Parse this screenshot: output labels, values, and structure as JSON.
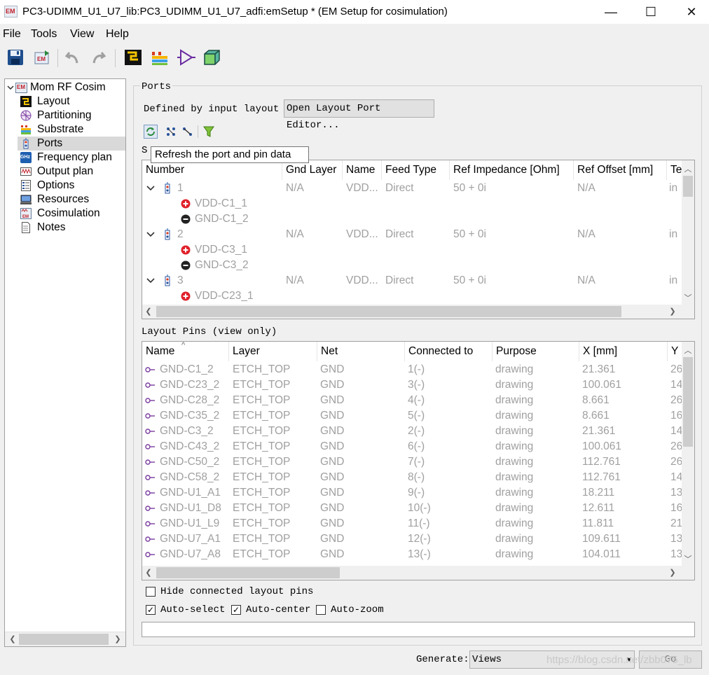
{
  "window": {
    "title": "PC3-UDIMM_U1_U7_lib:PC3_UDIMM_U1_U7_adfi:emSetup * (EM Setup for cosimulation)",
    "app_icon_text": "EM",
    "minimize_glyph": "—",
    "maximize_glyph": "☐",
    "close_glyph": "✕"
  },
  "menubar": {
    "items": [
      "File",
      "Tools",
      "View",
      "Help"
    ]
  },
  "toolbar": {
    "icons": [
      "save-icon",
      "em-export-icon",
      "undo-icon",
      "redo-icon",
      "layout-icon",
      "substrate-icon",
      "amplifier-icon",
      "3d-view-icon"
    ]
  },
  "tree": {
    "root": {
      "label": "Mom RF Cosim",
      "icon": "em-icon",
      "badge": "EM"
    },
    "items": [
      {
        "label": "Layout",
        "icon": "layout-icon"
      },
      {
        "label": "Partitioning",
        "icon": "partitioning-icon"
      },
      {
        "label": "Substrate",
        "icon": "substrate-icon"
      },
      {
        "label": "Ports",
        "icon": "ports-icon",
        "selected": true
      },
      {
        "label": "Frequency plan",
        "icon": "frequency-plan-icon",
        "badge": "GHz"
      },
      {
        "label": "Output plan",
        "icon": "output-plan-icon"
      },
      {
        "label": "Options",
        "icon": "options-icon"
      },
      {
        "label": "Resources",
        "icon": "resources-icon"
      },
      {
        "label": "Cosimulation",
        "icon": "cosimulation-icon"
      },
      {
        "label": "Notes",
        "icon": "notes-icon"
      }
    ]
  },
  "ports": {
    "group_title": "Ports",
    "defined_label": "Defined by input layout",
    "open_editor_button": "Open Layout Port Editor...",
    "tooltip": "Refresh the port and pin data",
    "s_fragment": "S",
    "table": {
      "columns": [
        "Number",
        "Gnd Layer",
        "Name",
        "Feed Type",
        "Ref Impedance [Ohm]",
        "Ref Offset [mm]",
        "Te"
      ],
      "rows": [
        {
          "number": "1",
          "gnd_layer": "N/A",
          "name": "VDD...",
          "feed": "Direct",
          "impedance": "50 + 0i",
          "offset": "N/A",
          "te": "in",
          "pins": [
            {
              "sign": "+",
              "label": "VDD-C1_1"
            },
            {
              "sign": "-",
              "label": "GND-C1_2"
            }
          ]
        },
        {
          "number": "2",
          "gnd_layer": "N/A",
          "name": "VDD...",
          "feed": "Direct",
          "impedance": "50 + 0i",
          "offset": "N/A",
          "te": "in",
          "pins": [
            {
              "sign": "+",
              "label": "VDD-C3_1"
            },
            {
              "sign": "-",
              "label": "GND-C3_2"
            }
          ]
        },
        {
          "number": "3",
          "gnd_layer": "N/A",
          "name": "VDD...",
          "feed": "Direct",
          "impedance": "50 + 0i",
          "offset": "N/A",
          "te": "in",
          "pins": [
            {
              "sign": "+",
              "label": "VDD-C23_1"
            }
          ]
        }
      ]
    }
  },
  "layout_pins": {
    "label": "Layout Pins (view only)",
    "sort_glyph": "^",
    "columns": [
      "Name",
      "Layer",
      "Net",
      "Connected to",
      "Purpose",
      "X [mm]",
      "Y"
    ],
    "rows": [
      {
        "name": "GND-C1_2",
        "layer": "ETCH_TOP",
        "net": "GND",
        "connected": "1(-)",
        "purpose": "drawing",
        "x": "21.361",
        "y": "26"
      },
      {
        "name": "GND-C23_2",
        "layer": "ETCH_TOP",
        "net": "GND",
        "connected": "3(-)",
        "purpose": "drawing",
        "x": "100.061",
        "y": "14"
      },
      {
        "name": "GND-C28_2",
        "layer": "ETCH_TOP",
        "net": "GND",
        "connected": "4(-)",
        "purpose": "drawing",
        "x": "8.661",
        "y": "26"
      },
      {
        "name": "GND-C35_2",
        "layer": "ETCH_TOP",
        "net": "GND",
        "connected": "5(-)",
        "purpose": "drawing",
        "x": "8.661",
        "y": "16"
      },
      {
        "name": "GND-C3_2",
        "layer": "ETCH_TOP",
        "net": "GND",
        "connected": "2(-)",
        "purpose": "drawing",
        "x": "21.361",
        "y": "14"
      },
      {
        "name": "GND-C43_2",
        "layer": "ETCH_TOP",
        "net": "GND",
        "connected": "6(-)",
        "purpose": "drawing",
        "x": "100.061",
        "y": "26"
      },
      {
        "name": "GND-C50_2",
        "layer": "ETCH_TOP",
        "net": "GND",
        "connected": "7(-)",
        "purpose": "drawing",
        "x": "112.761",
        "y": "26"
      },
      {
        "name": "GND-C58_2",
        "layer": "ETCH_TOP",
        "net": "GND",
        "connected": "8(-)",
        "purpose": "drawing",
        "x": "112.761",
        "y": "14"
      },
      {
        "name": "GND-U1_A1",
        "layer": "ETCH_TOP",
        "net": "GND",
        "connected": "9(-)",
        "purpose": "drawing",
        "x": "18.211",
        "y": "13"
      },
      {
        "name": "GND-U1_D8",
        "layer": "ETCH_TOP",
        "net": "GND",
        "connected": "10(-)",
        "purpose": "drawing",
        "x": "12.611",
        "y": "16"
      },
      {
        "name": "GND-U1_L9",
        "layer": "ETCH_TOP",
        "net": "GND",
        "connected": "11(-)",
        "purpose": "drawing",
        "x": "11.811",
        "y": "21"
      },
      {
        "name": "GND-U7_A1",
        "layer": "ETCH_TOP",
        "net": "GND",
        "connected": "12(-)",
        "purpose": "drawing",
        "x": "109.611",
        "y": "13"
      },
      {
        "name": "GND-U7_A8",
        "layer": "ETCH_TOP",
        "net": "GND",
        "connected": "13(-)",
        "purpose": "drawing",
        "x": "104.011",
        "y": "13"
      }
    ]
  },
  "options": {
    "hide_connected": {
      "label": "Hide connected layout pins",
      "checked": false
    },
    "auto_select": {
      "label": "Auto-select",
      "checked": true
    },
    "auto_center": {
      "label": "Auto-center",
      "checked": true
    },
    "auto_zoom": {
      "label": "Auto-zoom",
      "checked": false
    }
  },
  "generate": {
    "label": "Generate:",
    "value": "Views",
    "go_label": "Go"
  },
  "watermark": "https://blog.csdn.net/zbb075_lb",
  "check_glyph": "✓"
}
